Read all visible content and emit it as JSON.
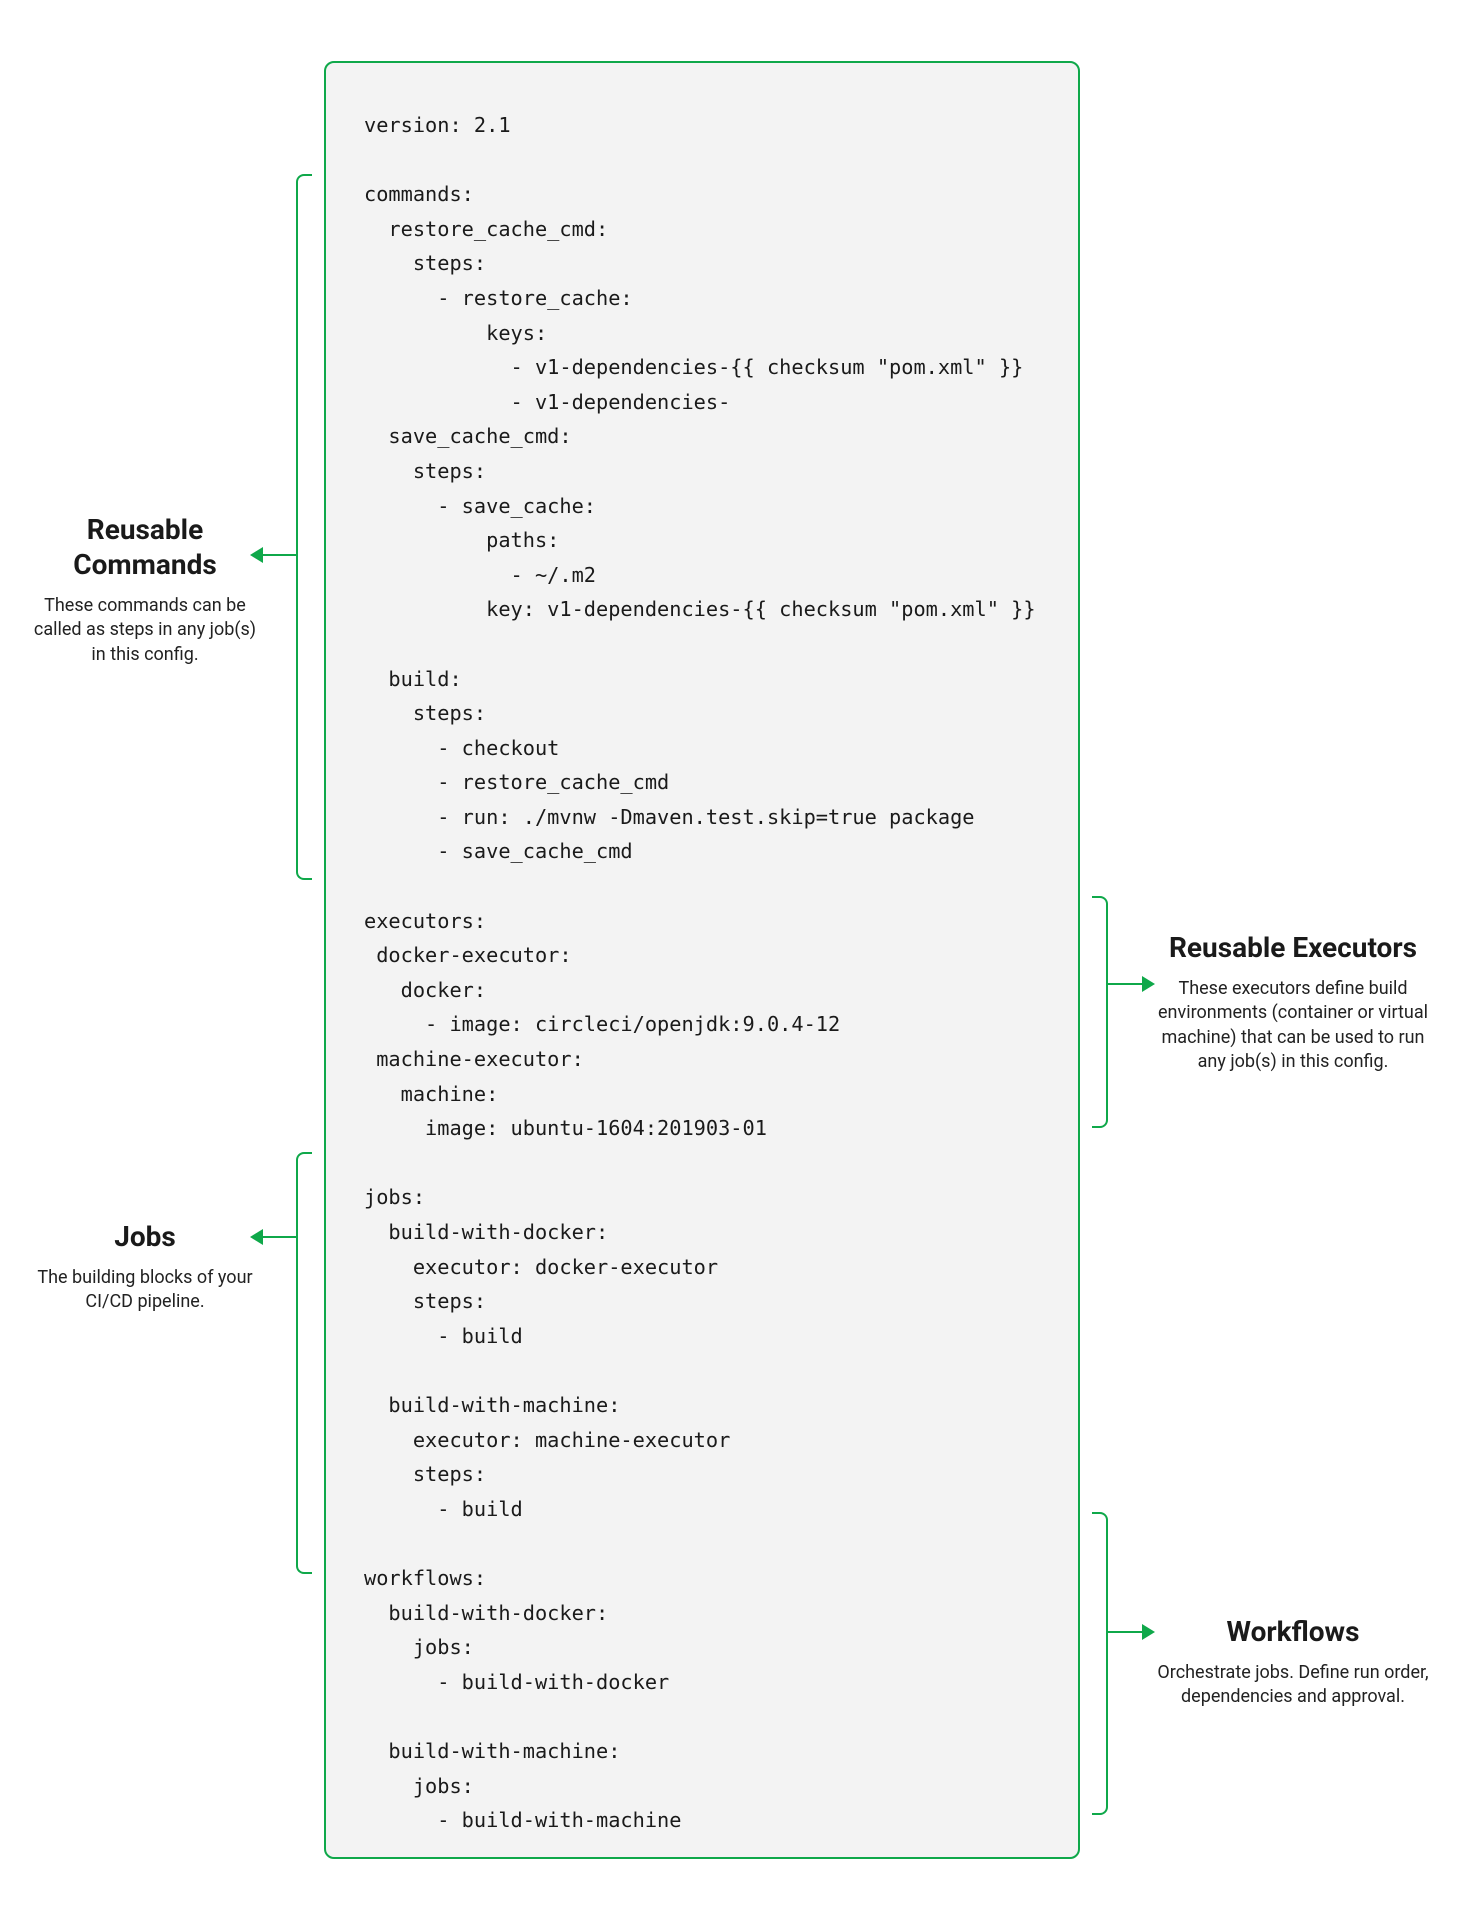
{
  "code": "version: 2.1\n\ncommands:\n  restore_cache_cmd:\n    steps:\n      - restore_cache:\n          keys:\n            - v1-dependencies-{{ checksum \"pom.xml\" }}\n            - v1-dependencies-\n  save_cache_cmd:\n    steps:\n      - save_cache:\n          paths:\n            - ~/.m2\n          key: v1-dependencies-{{ checksum \"pom.xml\" }}\n\n  build:\n    steps:\n      - checkout\n      - restore_cache_cmd\n      - run: ./mvnw -Dmaven.test.skip=true package\n      - save_cache_cmd\n\nexecutors:\n docker-executor:\n   docker:\n     - image: circleci/openjdk:9.0.4-12\n machine-executor:\n   machine:\n     image: ubuntu-1604:201903-01\n\njobs:\n  build-with-docker:\n    executor: docker-executor\n    steps:\n      - build\n\n  build-with-machine:\n    executor: machine-executor\n    steps:\n      - build\n\nworkflows:\n  build-with-docker:\n    jobs:\n      - build-with-docker\n\n  build-with-machine:\n    jobs:\n      - build-with-machine",
  "annotations": {
    "reusable_commands": {
      "title": "Reusable Commands",
      "desc": "These commands can be called as steps in any job(s) in this config."
    },
    "jobs": {
      "title": "Jobs",
      "desc": "The building blocks of your CI/CD pipeline."
    },
    "reusable_executors": {
      "title": "Reusable Executors",
      "desc": "These executors define build environments (container or virtual machine) that can be used to run any job(s) in this config."
    },
    "workflows": {
      "title": "Workflows",
      "desc": "Orchestrate jobs. Define run order, dependencies and approval."
    }
  }
}
